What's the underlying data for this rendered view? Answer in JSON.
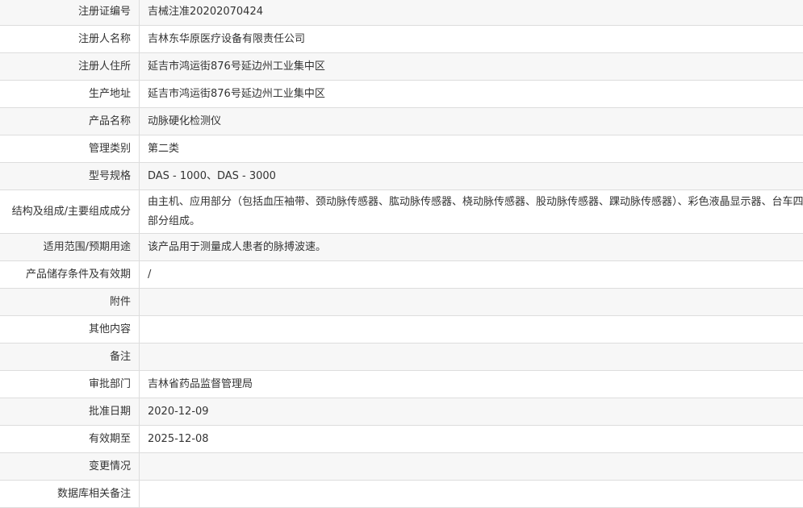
{
  "rows": [
    {
      "label": "注册证编号",
      "value": "吉械注准20202070424"
    },
    {
      "label": "注册人名称",
      "value": "吉林东华原医疗设备有限责任公司"
    },
    {
      "label": "注册人住所",
      "value": "延吉市鸿运街876号延边州工业集中区"
    },
    {
      "label": "生产地址",
      "value": "延吉市鸿运街876号延边州工业集中区"
    },
    {
      "label": "产品名称",
      "value": "动脉硬化检测仪"
    },
    {
      "label": "管理类别",
      "value": "第二类"
    },
    {
      "label": "型号规格",
      "value": "DAS - 1000、DAS - 3000"
    },
    {
      "label": "结构及组成/主要组成成分",
      "value": "由主机、应用部分（包括血压袖带、颈动脉传感器、肱动脉传感器、桡动脉传感器、股动脉传感器、踝动脉传感器）、彩色液晶显示器、台车四部分组成。"
    },
    {
      "label": "适用范围/预期用途",
      "value": "该产品用于测量成人患者的脉搏波速。"
    },
    {
      "label": "产品储存条件及有效期",
      "value": "/"
    },
    {
      "label": "附件",
      "value": ""
    },
    {
      "label": "其他内容",
      "value": ""
    },
    {
      "label": "备注",
      "value": ""
    },
    {
      "label": "审批部门",
      "value": "吉林省药品监督管理局"
    },
    {
      "label": "批准日期",
      "value": "2020-12-09"
    },
    {
      "label": "有效期至",
      "value": "2025-12-08"
    },
    {
      "label": "变更情况",
      "value": ""
    },
    {
      "label": "数据库相关备注",
      "value": ""
    }
  ]
}
